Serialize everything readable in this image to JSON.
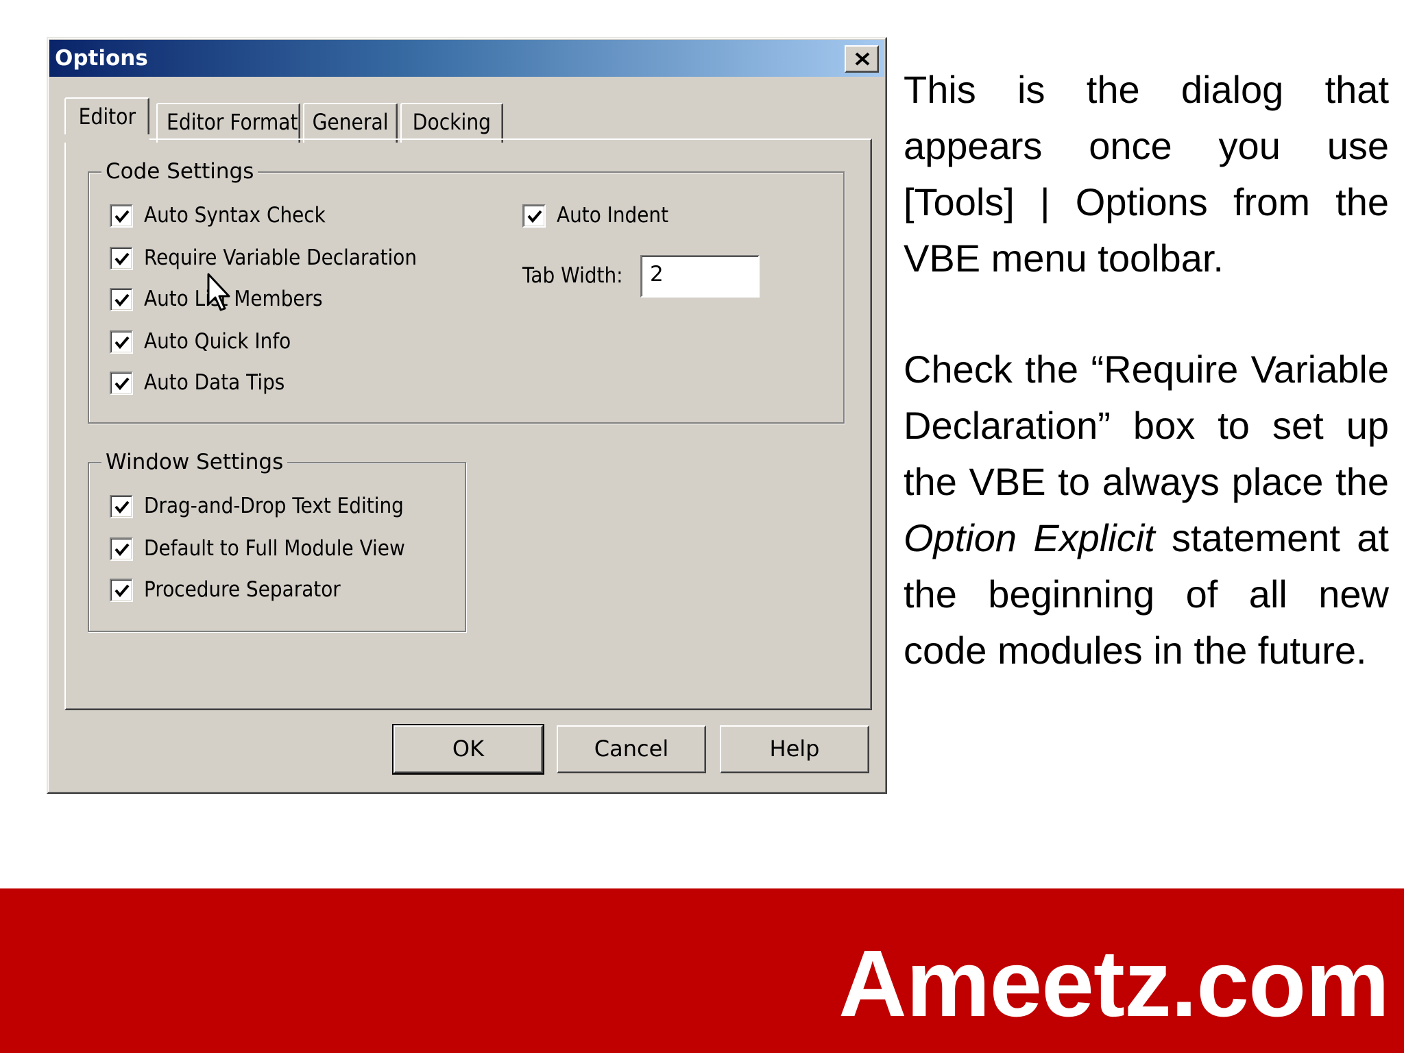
{
  "dialog": {
    "title": "Options",
    "tabs": [
      {
        "label": "Editor",
        "active": true
      },
      {
        "label": "Editor Format",
        "active": false
      },
      {
        "label": "General",
        "active": false
      },
      {
        "label": "Docking",
        "active": false
      }
    ],
    "code_settings": {
      "legend": "Code Settings",
      "checkboxes": [
        {
          "label": "Auto Syntax Check",
          "checked": true
        },
        {
          "label": "Require Variable Declaration",
          "checked": true
        },
        {
          "label": "Auto List Members",
          "checked": true
        },
        {
          "label": "Auto Quick Info",
          "checked": true
        },
        {
          "label": "Auto Data Tips",
          "checked": true
        },
        {
          "label": "Auto Indent",
          "checked": true
        }
      ],
      "tab_width_label": "Tab Width:",
      "tab_width_value": "2"
    },
    "window_settings": {
      "legend": "Window Settings",
      "checkboxes": [
        {
          "label": "Drag-and-Drop Text Editing",
          "checked": true
        },
        {
          "label": "Default to Full Module View",
          "checked": true
        },
        {
          "label": "Procedure Separator",
          "checked": true
        }
      ]
    },
    "buttons": {
      "ok": "OK",
      "cancel": "Cancel",
      "help": "Help"
    }
  },
  "explanation": {
    "paragraph1": "This is the dialog that appears once you use [Tools] | Options from the VBE menu toolbar.",
    "paragraph2_part1": "Check the “Require Variable Declaration” box to set up the VBE to always place the ",
    "paragraph2_italic": "Option Explicit",
    "paragraph2_part2": " statement at the beginning of all new code modules in the future."
  },
  "footer": {
    "brand": "Ameetz.com"
  },
  "colors": {
    "titlebar_start": "#0a246a",
    "titlebar_end": "#a6caf0",
    "dialog_face": "#d4d0c8",
    "footer": "#c00000"
  }
}
